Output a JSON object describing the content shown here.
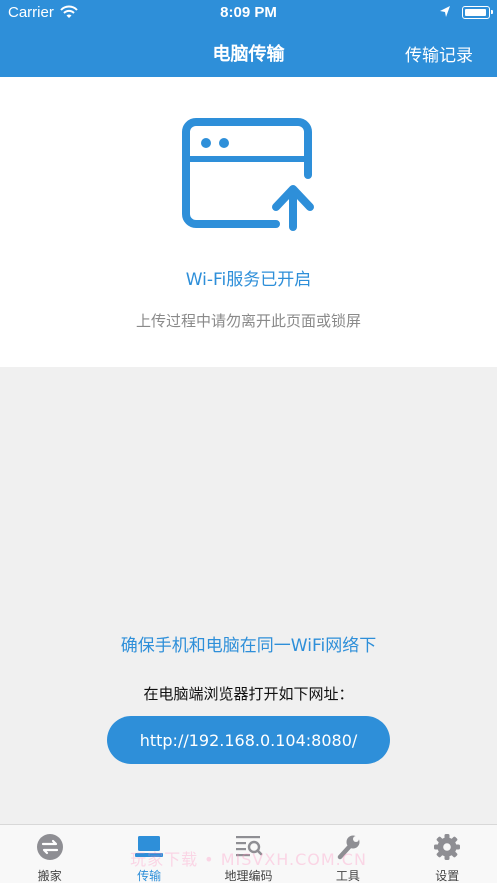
{
  "status_bar": {
    "carrier": "Carrier",
    "time": "8:09 PM"
  },
  "nav": {
    "title": "电脑传输",
    "right_action": "传输记录"
  },
  "hero": {
    "icon": "browser-upload-icon",
    "title": "Wi-Fi服务已开启",
    "subtitle": "上传过程中请勿离开此页面或锁屏"
  },
  "instructions": {
    "ensure_network": "确保手机和电脑在同一WiFi网络下",
    "open_browser": "在电脑端浏览器打开如下网址：",
    "url": "http://192.168.0.104:8080/"
  },
  "tabs": [
    {
      "label": "搬家",
      "icon": "swap-icon"
    },
    {
      "label": "传输",
      "icon": "laptop-icon"
    },
    {
      "label": "地理编码",
      "icon": "map-search-icon"
    },
    {
      "label": "工具",
      "icon": "wrench-icon"
    },
    {
      "label": "设置",
      "icon": "gear-icon"
    }
  ],
  "watermark": "玩家下载 • MISVXH.COM.CN",
  "colors": {
    "accent": "#2e8fd9",
    "tab_inactive": "#8e8e93",
    "background": "#f0f0f0"
  }
}
